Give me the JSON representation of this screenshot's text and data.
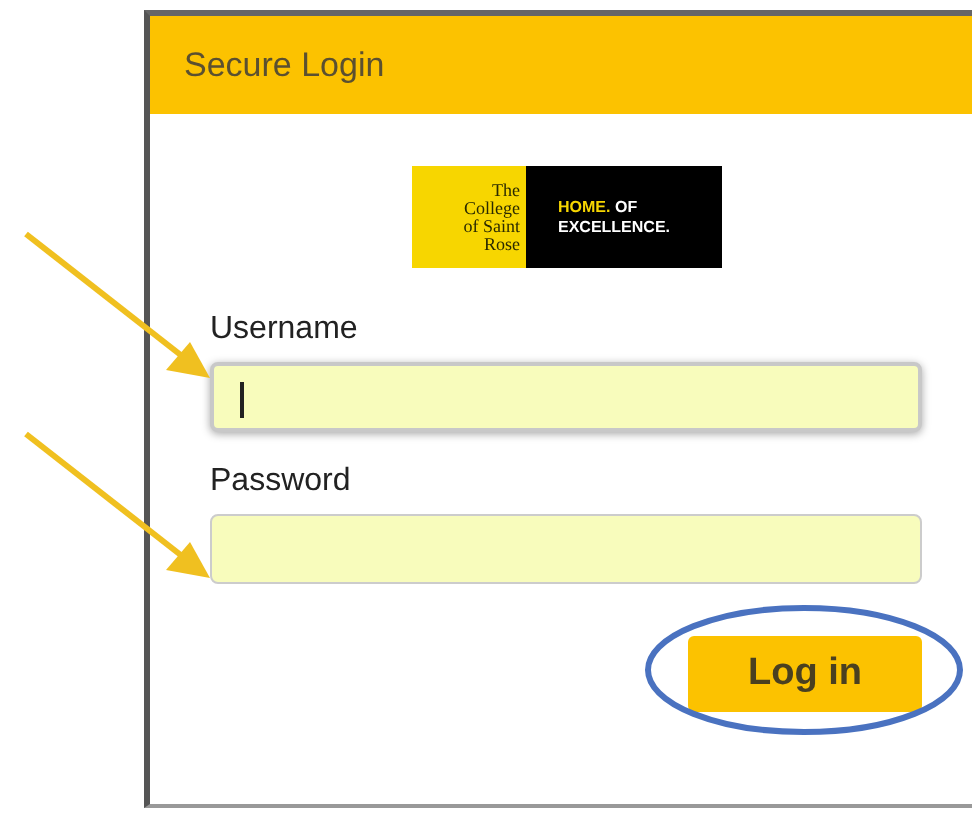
{
  "header": {
    "title": "Secure Login"
  },
  "logo": {
    "college": [
      "The",
      "College",
      "of Saint",
      "Rose"
    ],
    "tagline_highlight": "HOME.",
    "tagline": [
      "OF",
      "EXCELLENCE."
    ]
  },
  "fields": [
    {
      "label": "Username",
      "focused": true
    },
    {
      "label": "Password",
      "focused": false
    }
  ],
  "button": {
    "label": "Log in"
  }
}
